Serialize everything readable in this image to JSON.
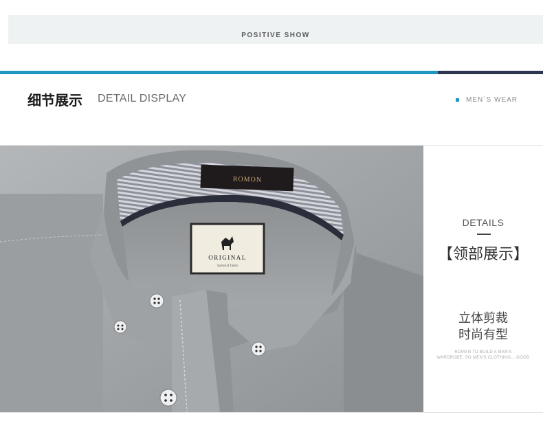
{
  "banner": {
    "text": "POSITIVE SHOW"
  },
  "section": {
    "title_cn": "细节展示",
    "title_en": "DETAIL DISPLAY",
    "tag": "MEN`S  WEAR"
  },
  "photo": {
    "collar_label": "ROMON",
    "tag_line1": "ORIGINAL",
    "tag_line2": "Sartorial Tailor"
  },
  "details": {
    "label_en": "DETAILS",
    "label_cn": "【领部展示】",
    "slogan_line1": "立体剪裁",
    "slogan_line2": "时尚有型",
    "small_line1": "ROMAN TO BUILD A MAN'S",
    "small_line2": "WARDROBE, SO MEN'S CLOTHING... GOOD"
  },
  "colors": {
    "accent": "#1e96c2",
    "dark": "#2b3650"
  }
}
